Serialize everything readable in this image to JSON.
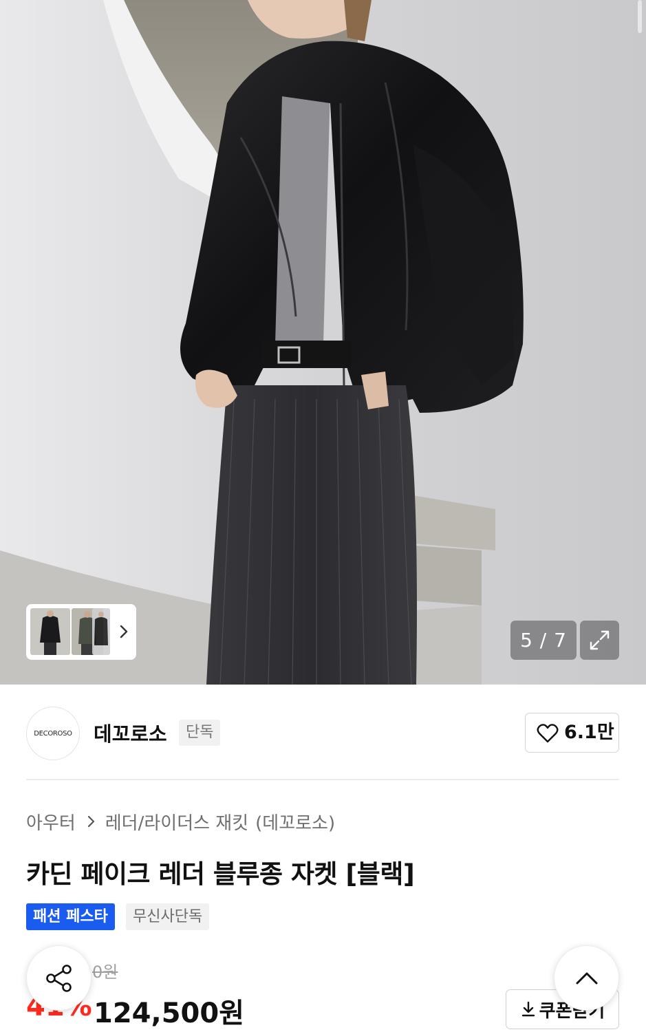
{
  "gallery": {
    "counter": "5 / 7",
    "expand_icon": "expand-icon",
    "thumbs_next_icon": "chevron-right-icon"
  },
  "brand": {
    "logo_text": "DECOROSO",
    "name": "데꼬로소",
    "badge": "단독",
    "like_count": "6.1만",
    "like_icon": "heart-icon"
  },
  "breadcrumb": {
    "category": "아우터",
    "subcategory": "레더/라이더스 재킷",
    "brand_suffix": "(데꼬로소)"
  },
  "product": {
    "title": "카딘 페이크 레더 블루종 자켓 [블랙]",
    "tags": [
      "패션 페스타",
      "무신사단독"
    ],
    "original_price": "0원",
    "discount": "41%",
    "price": "124,500원"
  },
  "actions": {
    "coupon_label": "쿠폰받기",
    "share_icon": "share-icon",
    "top_icon": "chevron-up-icon"
  },
  "colors": {
    "tag_blue": "#1a5cf0",
    "discount_red": "#ff2a1f"
  }
}
